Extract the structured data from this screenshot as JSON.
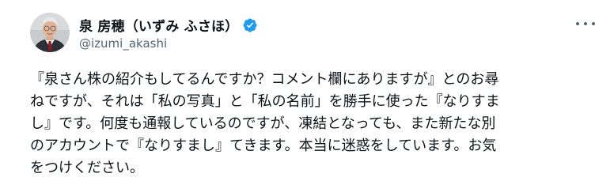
{
  "author": {
    "display_name": "泉 房穂（いずみ ふさほ）",
    "handle": "@izumi_akashi",
    "verified": true,
    "verified_color": "#1d9bf0"
  },
  "menu": {
    "icon": "more-horizontal-icon"
  },
  "tweet": {
    "lines": [
      "『泉さん株の紹介もしてるんですか？コメント欄にありますが』とのお尋",
      "ねですが、それは「私の写真」と「私の名前」を勝手に使った『なりすま",
      "し』です。何度も通報しているのですが、凍結となっても、また新たな別",
      "のアカウントで『なりすまし』てきます。本当に迷惑をしています。お気",
      "をつけください。"
    ]
  }
}
